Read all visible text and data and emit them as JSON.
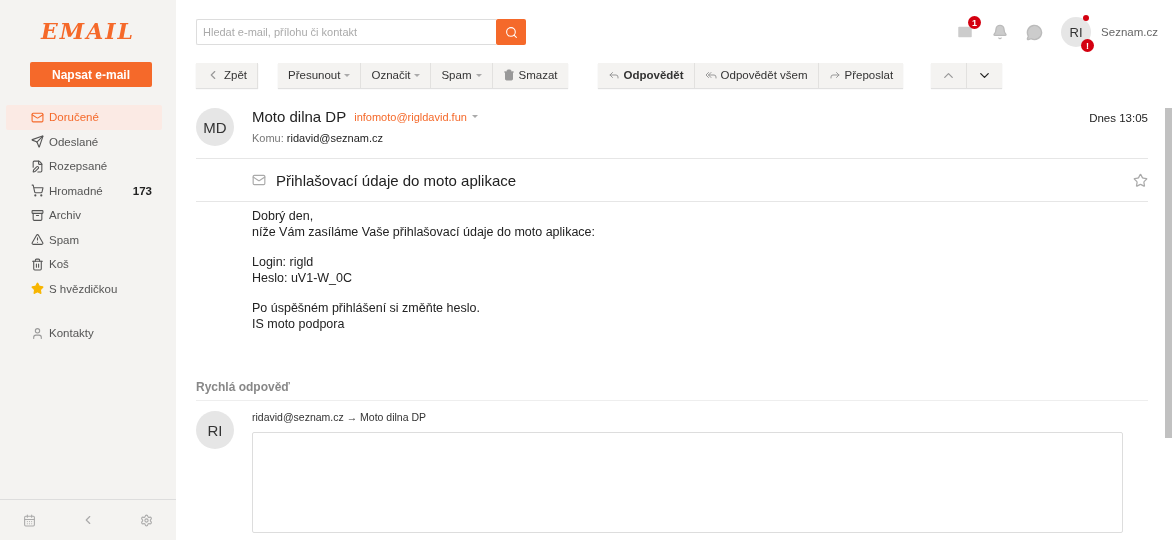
{
  "logo": "EMAIL",
  "compose_button": "Napsat e-mail",
  "sidebar": {
    "items": [
      {
        "label": "Doručené",
        "selected": true
      },
      {
        "label": "Odeslané",
        "selected": false
      },
      {
        "label": "Rozepsané",
        "selected": false
      },
      {
        "label": "Hromadné",
        "selected": false,
        "count": "173"
      },
      {
        "label": "Archiv",
        "selected": false
      },
      {
        "label": "Spam",
        "selected": false
      },
      {
        "label": "Koš",
        "selected": false
      },
      {
        "label": "S hvězdičkou",
        "selected": false
      }
    ],
    "contacts": "Kontakty"
  },
  "search": {
    "placeholder": "Hledat e-mail, přílohu či kontakt"
  },
  "header": {
    "mail_badge": "1",
    "avatar": "RI",
    "avatar_badge": "!",
    "brand": "Seznam.cz"
  },
  "toolbar": {
    "back": "Zpět",
    "groups": [
      [
        {
          "label": "Přesunout",
          "dropdown": true
        },
        {
          "label": "Označit",
          "dropdown": true
        },
        {
          "label": "Spam",
          "dropdown": true
        },
        {
          "label": "Smazat",
          "dropdown": false
        }
      ],
      [
        {
          "label": "Odpovědět",
          "dropdown": false,
          "default": true
        },
        {
          "label": "Odpovědět všem",
          "dropdown": false,
          "default": false
        },
        {
          "label": "Přeposlat",
          "dropdown": false,
          "default": false
        }
      ]
    ]
  },
  "message": {
    "avatar": "MD",
    "sender": "Moto dilna DP",
    "sender_email": "infomoto@rigldavid.fun",
    "to_label": "Komu:",
    "to": "ridavid@seznam.cz",
    "date": "Dnes 13:05",
    "subject": "Přihlašovací údaje do moto aplikace",
    "starred": false,
    "body": [
      [
        "Dobrý den,",
        "níže Vám zasíláme Vaše přihlašovací údaje do moto aplikace:"
      ],
      [
        "Login: rigld",
        "Heslo: uV1-W_0C"
      ],
      [
        "Po úspěšném přihlášení si změňte heslo.",
        "IS moto podpora"
      ]
    ]
  },
  "quick_reply": {
    "title": "Rychlá odpověď",
    "avatar": "RI",
    "route": "ridavid@seznam.cz → Moto dilna DP"
  }
}
